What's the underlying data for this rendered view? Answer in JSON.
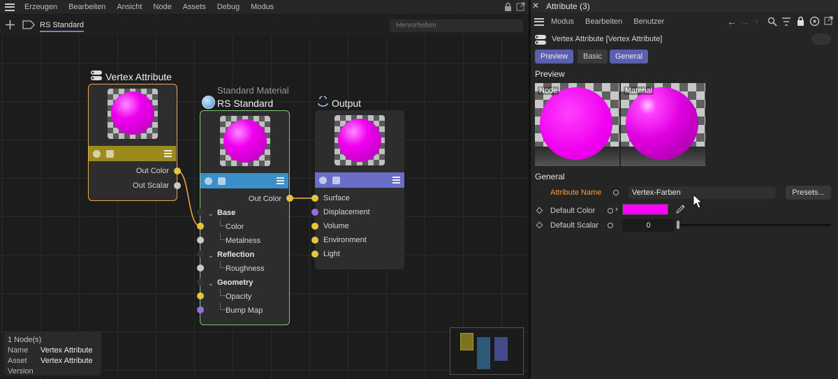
{
  "node_editor": {
    "menu": [
      "Erzeugen",
      "Bearbeiten",
      "Ansicht",
      "Node",
      "Assets",
      "Debug",
      "Modus"
    ],
    "active_tab": "RS Standard",
    "search_placeholder": "Hervorheben",
    "nodes": {
      "vertex_attribute": {
        "title": "Vertex Attribute",
        "outputs": [
          "Out Color",
          "Out Scalar"
        ],
        "bar_color": "#9c8a1e",
        "border_color": "#f0a850"
      },
      "rs_standard": {
        "subtitle": "Standard Material",
        "title": "RS Standard",
        "output": "Out Color",
        "bar_color": "#3a8fc8",
        "border_color": "#7ec87a",
        "groups": [
          {
            "name": "Base",
            "items": [
              "Color",
              "Metalness"
            ]
          },
          {
            "name": "Reflection",
            "items": [
              "Roughness"
            ]
          },
          {
            "name": "Geometry",
            "items": [
              "Opacity",
              "Bump Map"
            ]
          }
        ]
      },
      "output": {
        "title": "Output",
        "bar_color": "#6a6ec8",
        "inputs": [
          "Surface",
          "Displacement",
          "Volume",
          "Environment",
          "Light"
        ]
      }
    },
    "info": {
      "count": "1 Node(s)",
      "rows": [
        {
          "key": "Name",
          "value": "Vertex Attribute"
        },
        {
          "key": "Asset",
          "value": "Vertex Attribute"
        },
        {
          "key": "Version",
          "value": ""
        }
      ]
    }
  },
  "attributes": {
    "title": "Attribute (3)",
    "menu": [
      "Modus",
      "Bearbeiten",
      "Benutzer"
    ],
    "object_title": "Vertex Attribute [Vertex Attribute]",
    "tabs": [
      "Preview",
      "Basic",
      "General"
    ],
    "active_tabs": [
      "Preview",
      "General"
    ],
    "preview_section": "Preview",
    "preview_labels": [
      "Node",
      "Material"
    ],
    "general_section": "General",
    "attribute_name_label": "Attribute Name",
    "attribute_name_value": "Vertex-Farben",
    "presets_label": "Presets...",
    "default_color_label": "Default Color",
    "default_color_value": "#ff00ff",
    "default_scalar_label": "Default Scalar",
    "default_scalar_value": "0",
    "accent_color": "#f0a040"
  }
}
